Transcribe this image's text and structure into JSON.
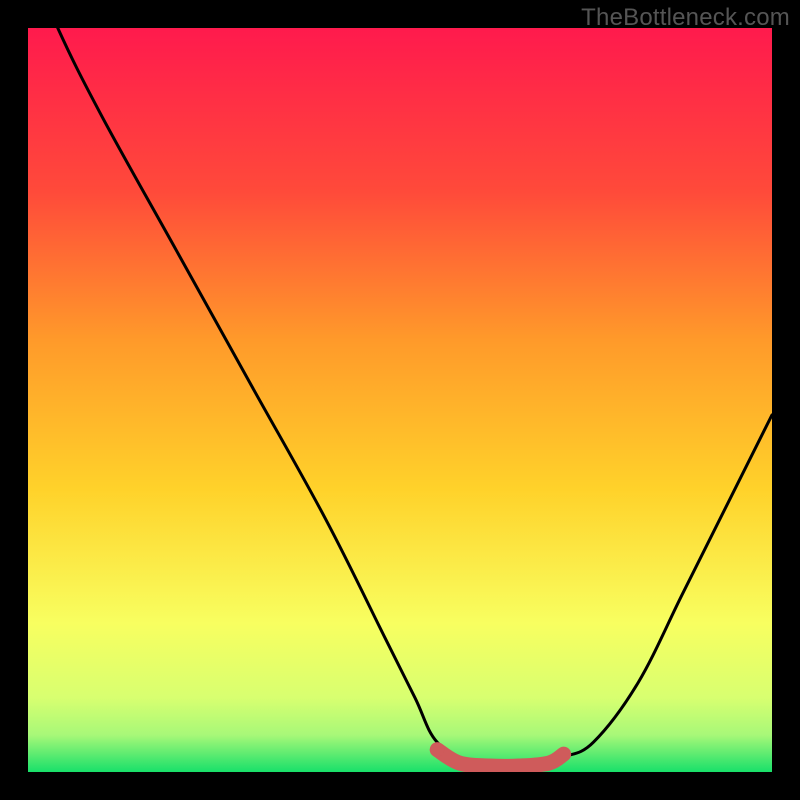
{
  "watermark": "TheBottleneck.com",
  "colors": {
    "frame": "#000000",
    "gradient_top": "#ff1a4d",
    "gradient_mid1": "#ff7a2a",
    "gradient_mid2": "#ffd22a",
    "gradient_mid3": "#f6ff6a",
    "gradient_bottom": "#18e06a",
    "curve": "#000000",
    "highlight": "#cf5b5b"
  },
  "chart_data": {
    "type": "line",
    "title": "",
    "xlabel": "",
    "ylabel": "",
    "xlim": [
      0,
      100
    ],
    "ylim": [
      0,
      100
    ],
    "series": [
      {
        "name": "bottleneck-curve",
        "x": [
          0,
          4,
          10,
          20,
          30,
          40,
          48,
          52,
          55,
          60,
          66,
          70,
          72,
          76,
          82,
          88,
          94,
          100
        ],
        "y": [
          110,
          100,
          88,
          70,
          52,
          34,
          18,
          10,
          4,
          1,
          1,
          1,
          2,
          4,
          12,
          24,
          36,
          48
        ]
      },
      {
        "name": "highlight-segment",
        "x": [
          55,
          58,
          62,
          66,
          70,
          72
        ],
        "y": [
          3.0,
          1.2,
          0.8,
          0.8,
          1.2,
          2.4
        ]
      }
    ],
    "annotations": [
      {
        "name": "highlight-start-dot",
        "x": 55,
        "y": 3.0
      }
    ]
  }
}
